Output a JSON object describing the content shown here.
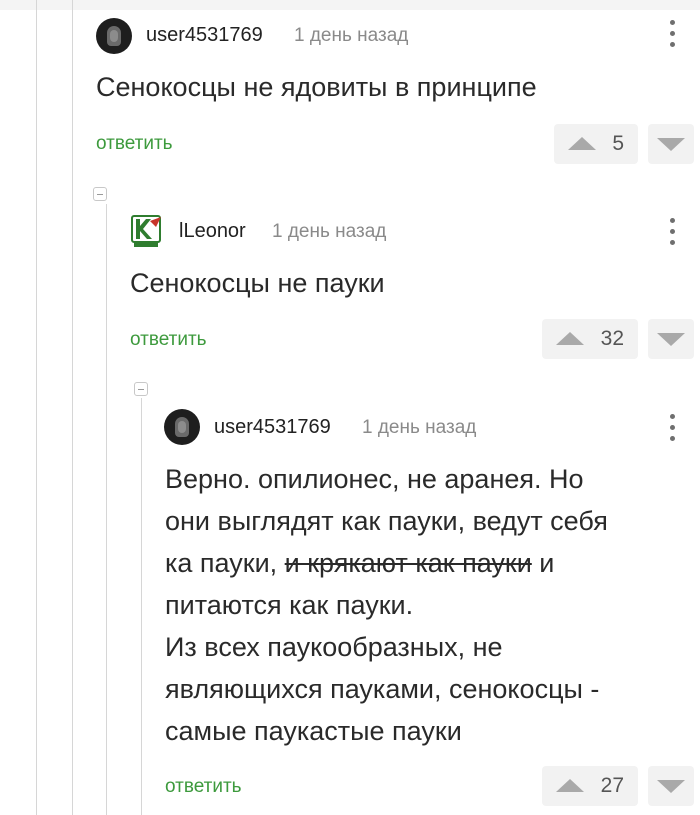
{
  "comments": [
    {
      "username": "user4531769",
      "time": "1 день назад",
      "text": "Сенокосцы не ядовиты в принципе",
      "reply_label": "ответить",
      "rating": "5"
    },
    {
      "username": "lLeonor",
      "time": "1 день назад",
      "text": "Сенокосцы не пауки",
      "reply_label": "ответить",
      "rating": "32"
    },
    {
      "username": "user4531769",
      "time": "1 день назад",
      "text_parts": {
        "line1": "Верно. опилионес, не аранея. Но",
        "line2": "они выглядят как пауки, ведут себя",
        "line3_pre": "ка пауки, ",
        "line3_strike": "и крякают как пауки",
        "line3_post": " и",
        "line4": "питаются как пауки.",
        "line5": "Из всех паукообразных, не",
        "line6": "являющихся пауками, сенокосцы -",
        "line7": "самые паукастые пауки"
      },
      "reply_label": "ответить",
      "rating": "27"
    }
  ],
  "icons": {
    "more": "more-vertical-icon",
    "upvote": "triangle-up-icon",
    "downvote": "triangle-down-icon",
    "collapse": "collapse-minus-icon"
  },
  "colors": {
    "reply_green": "#3d9a3d",
    "meta_gray": "#8a8a8a",
    "vote_bg": "#f2f2f2",
    "thread_line": "#d6d6d6"
  }
}
